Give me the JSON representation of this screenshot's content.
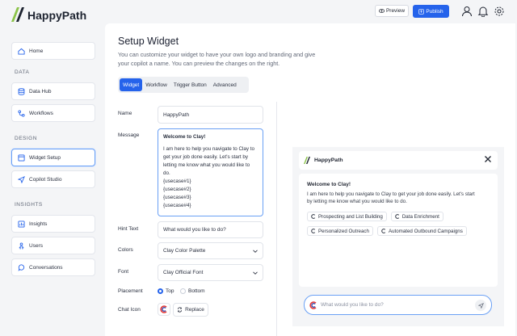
{
  "app": {
    "brand": "HappyPath"
  },
  "header": {
    "preview_label": "Preview",
    "publish_label": "Publish"
  },
  "sidebar": {
    "home": "Home",
    "section_data": "DATA",
    "data_hub": "Data Hub",
    "workflows": "Workflows",
    "section_design": "DESIGN",
    "widget_setup": "Widget Setup",
    "copilot_studio": "Copilot Studio",
    "section_insights": "INSIGHTS",
    "insights": "Insights",
    "users": "Users",
    "conversations": "Conversations"
  },
  "page": {
    "title": "Setup Widget",
    "description": "You can customize your widget to have your own logo and branding and give your copilot a name. You can preview the changes on the right."
  },
  "tabs": [
    "Widget",
    "Workflow",
    "Trigger Button",
    "Advanced"
  ],
  "form": {
    "name_label": "Name",
    "name_value": "HappyPath",
    "message_label": "Message",
    "message_title": "Welcome to Clay!",
    "message_body": "I am here to help you navigate to Clay to get your job done easily. Let's start by letting me know what you would like to do.",
    "usecases": [
      "{usecase#1}",
      "{usecase#2}",
      "{usecase#3}",
      "{usecase#4}"
    ],
    "hint_label": "Hint Text",
    "hint_value": "What would you like to do?",
    "colors_label": "Colors",
    "colors_value": "Clay Color Palette",
    "font_label": "Font",
    "font_value": "Clay Official Font",
    "placement_label": "Placement",
    "placement_top": "Top",
    "placement_bottom": "Bottom",
    "chat_icon_label": "Chat Icon",
    "replace_label": "Replace"
  },
  "preview": {
    "name": "HappyPath",
    "title": "Welcome to Clay!",
    "text": "I am here to help you navigate to Clay to get your job done easily. Let's start by letting me know what you would like to do.",
    "chips": [
      "Prospecting and List Building",
      "Data Enrichment",
      "Personalized Outreach",
      "Automated Outbound Campaigns"
    ],
    "input_placeholder": "What would you like to do?"
  },
  "colors": {
    "accent": "#2563eb",
    "active_border": "#6aa0f5",
    "logo_green": "#8bc34a"
  }
}
